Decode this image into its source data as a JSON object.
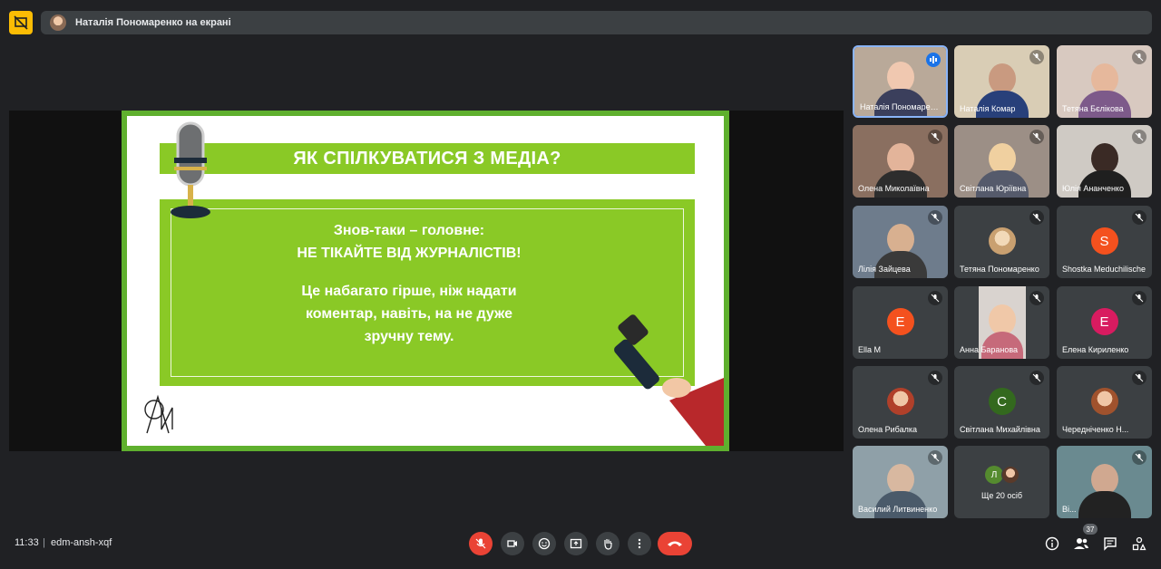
{
  "header": {
    "presenter_status": "Наталія Пономаренко на екрані"
  },
  "slide": {
    "title": "ЯК СПІЛКУВАТИСЯ З МЕДІА?",
    "line1": "Знов-таки – головне:",
    "line2": "НЕ ТІКАЙТЕ ВІД ЖУРНАЛІСТІВ!",
    "line3": "Це набагато гірше, ніж надати",
    "line4": "коментар, навіть, на не дуже",
    "line5": "зручну тему."
  },
  "participants": [
    {
      "name": "Наталія Пономаренко",
      "speaking": true
    },
    {
      "name": "Наталія Комар"
    },
    {
      "name": "Тетяна Бєлікова"
    },
    {
      "name": "Олена Миколаївна"
    },
    {
      "name": "Світлана Юріївна"
    },
    {
      "name": "Юлія Ананченко"
    },
    {
      "name": "Лілія Зайцева"
    },
    {
      "name": "Тетяна Пономаренко"
    },
    {
      "name": "Shostka Meduchilische",
      "initial": "S",
      "color": "#f4511e"
    },
    {
      "name": "Ella M",
      "initial": "E",
      "color": "#f4511e"
    },
    {
      "name": "Анна Баранова"
    },
    {
      "name": "Елена Кириленко",
      "initial": "E",
      "color": "#d81b60"
    },
    {
      "name": "Олена Рибалка"
    },
    {
      "name": "Світлана Михайлівна",
      "initial": "С",
      "color": "#33691e"
    },
    {
      "name": "Чередніченко Н..."
    },
    {
      "name": "Василий Литвиненко"
    },
    {
      "name": "Ще 20 осіб",
      "initial": "Л",
      "color": "#558b2f"
    },
    {
      "name": "Ві..."
    }
  ],
  "footer": {
    "time": "11:33",
    "separator": "|",
    "meeting_code": "edm-ansh-xqf",
    "participant_count": "37"
  },
  "colors": {
    "background": "#202124",
    "slide_green": "#8ac926",
    "end_call": "#ea4335",
    "presenting_badge": "#fbbc04"
  }
}
